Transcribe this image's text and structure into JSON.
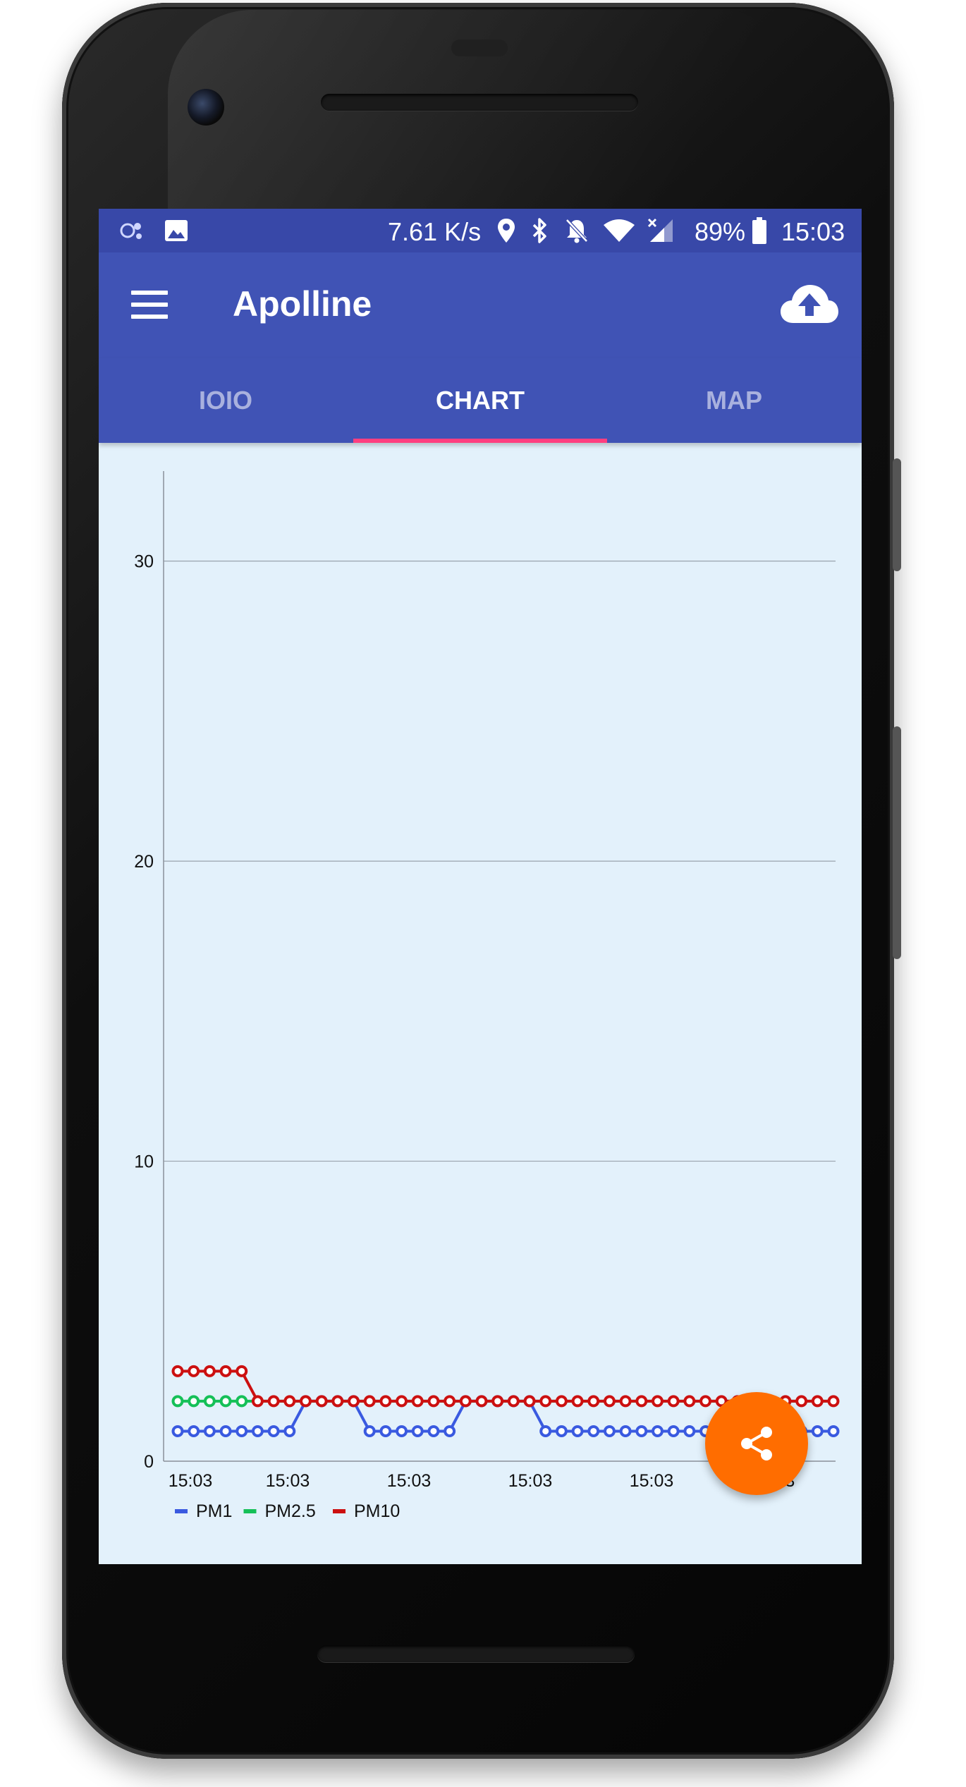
{
  "status_bar": {
    "network_speed": "7.61 K/s",
    "battery_percent": "89%",
    "time": "15:03",
    "icons": [
      "app-notification-icon",
      "image-icon",
      "location-icon",
      "bluetooth-icon",
      "notifications-off-icon",
      "wifi-icon",
      "signal-icon",
      "battery-icon"
    ]
  },
  "app_bar": {
    "title": "Apolline",
    "menu_icon": "menu-icon",
    "action_icon": "cloud-upload-icon"
  },
  "tabs": [
    {
      "label": "IOIO",
      "active": false
    },
    {
      "label": "CHART",
      "active": true
    },
    {
      "label": "MAP",
      "active": false
    }
  ],
  "colors": {
    "primary_dark": "#3848a8",
    "primary": "#4053b5",
    "accent": "#ff3f80",
    "fab": "#ff6d00",
    "chart_bg": "#e3f1fb"
  },
  "fab": {
    "icon": "share-icon"
  },
  "chart_data": {
    "type": "line",
    "y_ticks": [
      "0",
      "10",
      "20",
      "30"
    ],
    "ylim": [
      0,
      33
    ],
    "x_tick_labels": [
      "15:03",
      "15:03",
      "15:03",
      "15:03",
      "15:03",
      "15:03"
    ],
    "grid": true,
    "legend_position": "bottom-left",
    "series": [
      {
        "name": "PM1",
        "color": "#3a5ae0",
        "values": [
          1,
          1,
          1,
          1,
          1,
          1,
          1,
          1,
          2,
          2,
          2,
          2,
          1,
          1,
          1,
          1,
          1,
          1,
          2,
          2,
          2,
          2,
          2,
          1,
          1,
          1,
          1,
          1,
          1,
          1,
          1,
          1,
          1,
          1,
          1,
          1,
          1,
          1,
          1,
          1,
          1,
          1
        ]
      },
      {
        "name": "PM2.5",
        "color": "#15c058",
        "values": [
          2,
          2,
          2,
          2,
          2,
          2,
          2,
          2,
          2,
          2,
          2,
          2,
          2,
          2,
          2,
          2,
          2,
          2,
          2,
          2,
          2,
          2,
          2,
          2,
          2,
          2,
          2,
          2,
          2,
          2,
          2,
          2,
          2,
          2,
          2,
          2,
          2,
          2,
          2,
          2,
          2,
          2
        ]
      },
      {
        "name": "PM10",
        "color": "#cc1010",
        "values": [
          3,
          3,
          3,
          3,
          3,
          2,
          2,
          2,
          2,
          2,
          2,
          2,
          2,
          2,
          2,
          2,
          2,
          2,
          2,
          2,
          2,
          2,
          2,
          2,
          2,
          2,
          2,
          2,
          2,
          2,
          2,
          2,
          2,
          2,
          2,
          2,
          2,
          2,
          2,
          2,
          2,
          2
        ]
      }
    ]
  }
}
